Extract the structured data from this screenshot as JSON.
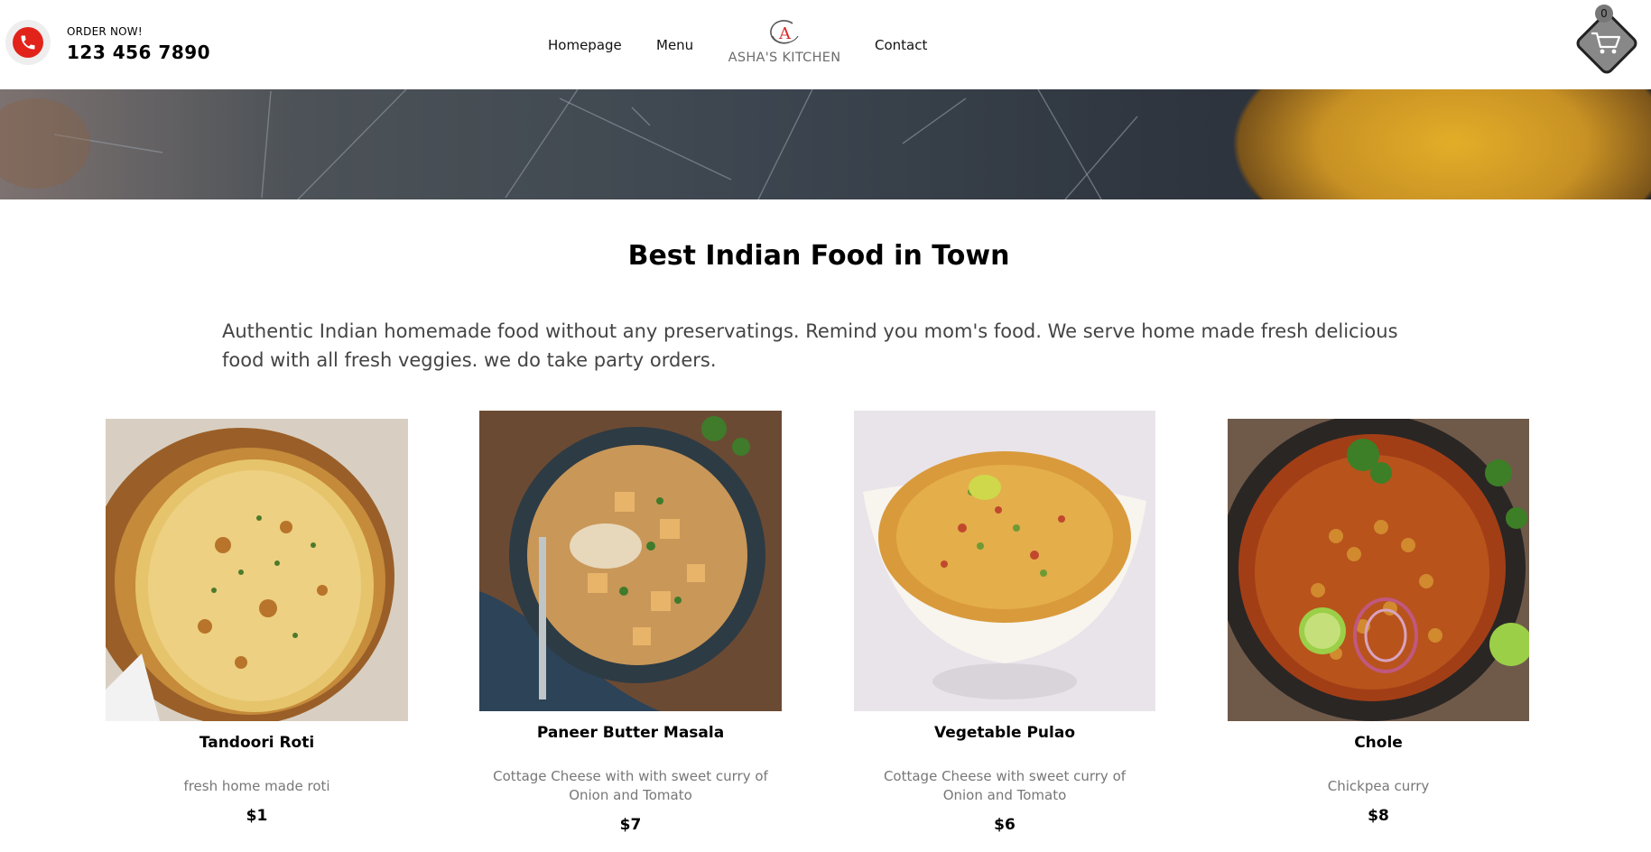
{
  "header": {
    "order_label": "ORDER NOW!",
    "phone": "123 456 7890",
    "nav": [
      "Homepage",
      "Menu",
      "Contact"
    ],
    "logo_text": "ASHA'S KITCHEN",
    "cart_count": "0"
  },
  "main": {
    "headline": "Best Indian Food in Town",
    "intro": "Authentic Indian homemade food without any preservatings. Remind you mom's food. We serve home made fresh delicious food with all fresh veggies. we do take party orders."
  },
  "products": [
    {
      "name": "Tandoori Roti",
      "desc": "fresh home made roti",
      "price": "$1"
    },
    {
      "name": "Paneer Butter Masala",
      "desc": "Cottage Cheese with with sweet curry of Onion and Tomato",
      "price": "$7"
    },
    {
      "name": "Vegetable Pulao",
      "desc": "Cottage Cheese with sweet curry of Onion and Tomato",
      "price": "$6"
    },
    {
      "name": "Chole",
      "desc": "Chickpea curry",
      "price": "$8"
    }
  ],
  "colors": {
    "accent": "#e2231a",
    "text": "#000000",
    "muted": "#777777"
  },
  "icons": [
    "phone-icon",
    "shopping-cart-icon"
  ]
}
